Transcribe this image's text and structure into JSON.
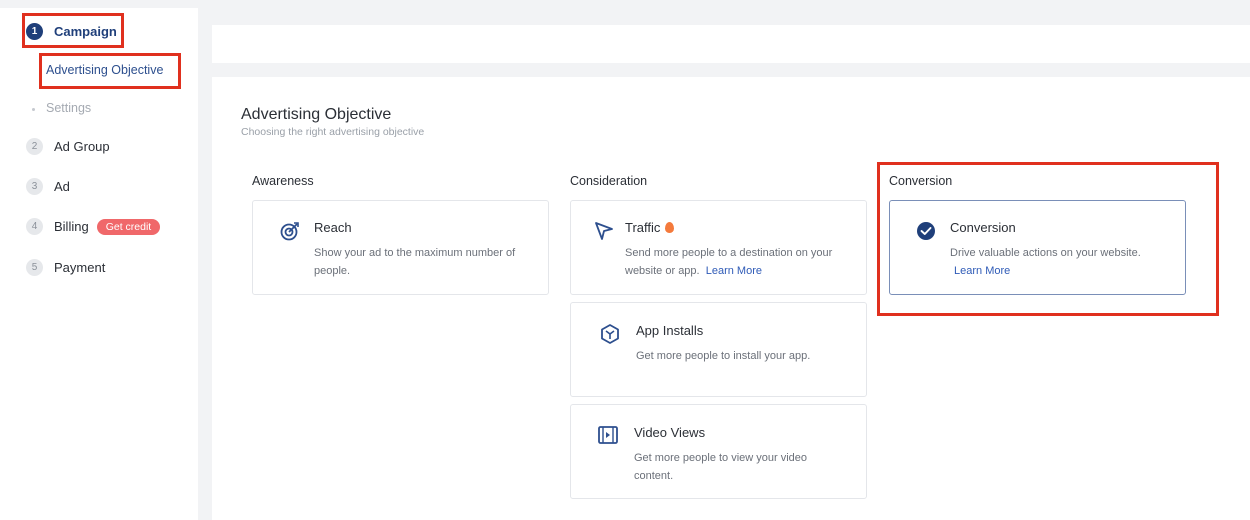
{
  "sidebar": {
    "steps": [
      {
        "num": "1",
        "label": "Campaign"
      },
      {
        "num": "2",
        "label": "Ad Group"
      },
      {
        "num": "3",
        "label": "Ad"
      },
      {
        "num": "4",
        "label": "Billing"
      },
      {
        "num": "5",
        "label": "Payment"
      }
    ],
    "substeps": [
      "Advertising Objective",
      "Settings"
    ],
    "billing_badge": "Get credit"
  },
  "main": {
    "title": "Advertising Objective",
    "subtitle": "Choosing the right advertising objective",
    "columns": [
      {
        "title": "Awareness",
        "cards": [
          {
            "title": "Reach",
            "desc_line1": "Show your ad to the maximum number of",
            "desc_line2": "people.",
            "icon": "reach-icon"
          }
        ]
      },
      {
        "title": "Consideration",
        "cards": [
          {
            "title": "Traffic",
            "desc_line1": "Send more people to a destination on your",
            "desc_line2": "website or app.",
            "link": "Learn More",
            "icon": "cursor-icon"
          },
          {
            "title": "App Installs",
            "desc_line1": "Get more people to install your app.",
            "icon": "app-cube-icon"
          },
          {
            "title": "Video Views",
            "desc_line1": "Get more people to view your video",
            "desc_line2": "content.",
            "icon": "video-icon"
          }
        ]
      },
      {
        "title": "Conversion",
        "cards": [
          {
            "title": "Conversion",
            "desc_line1": "Drive valuable actions on your website.",
            "link": "Learn More",
            "icon": "check-circle-icon",
            "selected": true
          }
        ]
      }
    ]
  },
  "colors": {
    "accent": "#1f3f7a",
    "link": "#2f5bb7",
    "highlight": "#e0301e",
    "badge": "#f0686a"
  }
}
